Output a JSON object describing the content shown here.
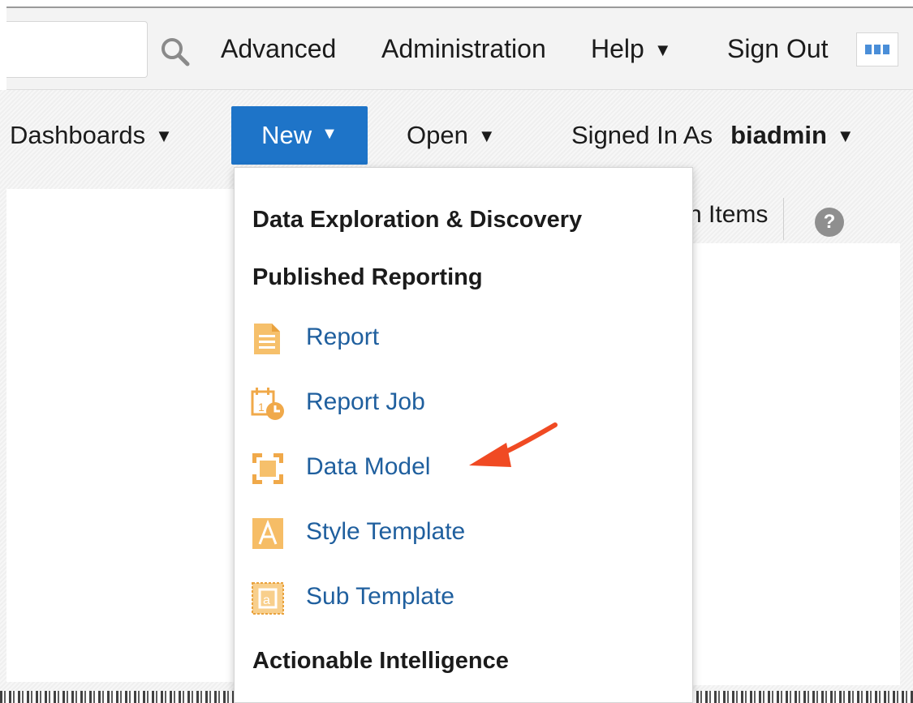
{
  "header": {
    "advanced": "Advanced",
    "administration": "Administration",
    "help": "Help",
    "sign_out": "Sign Out"
  },
  "subnav": {
    "dashboards": "Dashboards",
    "new": "New",
    "open": "Open",
    "signed_in_as": "Signed In As",
    "username": "biadmin"
  },
  "content": {
    "items_partial": "n Items",
    "help_glyph": "?"
  },
  "menu": {
    "headings": [
      "Data Exploration & Discovery",
      "Published Reporting",
      "Actionable Intelligence"
    ],
    "items": [
      {
        "label": "Report",
        "icon": "report-icon"
      },
      {
        "label": "Report Job",
        "icon": "report-job-icon"
      },
      {
        "label": "Data Model",
        "icon": "data-model-icon"
      },
      {
        "label": "Style Template",
        "icon": "style-template-icon"
      },
      {
        "label": "Sub Template",
        "icon": "sub-template-icon"
      }
    ]
  },
  "colors": {
    "accent": "#1e74c8",
    "link": "#1f5f9e",
    "icon_orange": "#f0a94a",
    "annotation_arrow": "#f04a23"
  }
}
